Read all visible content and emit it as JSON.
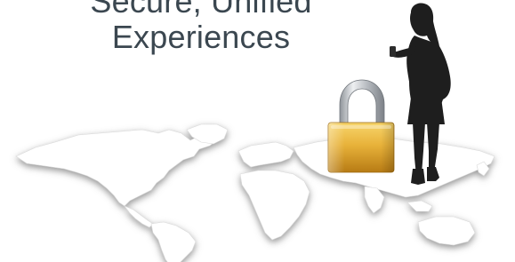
{
  "headline": {
    "line1": "Secure, Unified",
    "line2": "Experiences"
  },
  "illustration": {
    "map": "world-map",
    "lock": "padlock-icon",
    "figure": "woman-with-phone-silhouette"
  },
  "colors": {
    "headline": "#3b4750",
    "lock_gold": "#e8b23a",
    "lock_shackle": "#c9ccd1",
    "silhouette": "#1e1e1e",
    "map_shadow": "#8d8d8d"
  }
}
